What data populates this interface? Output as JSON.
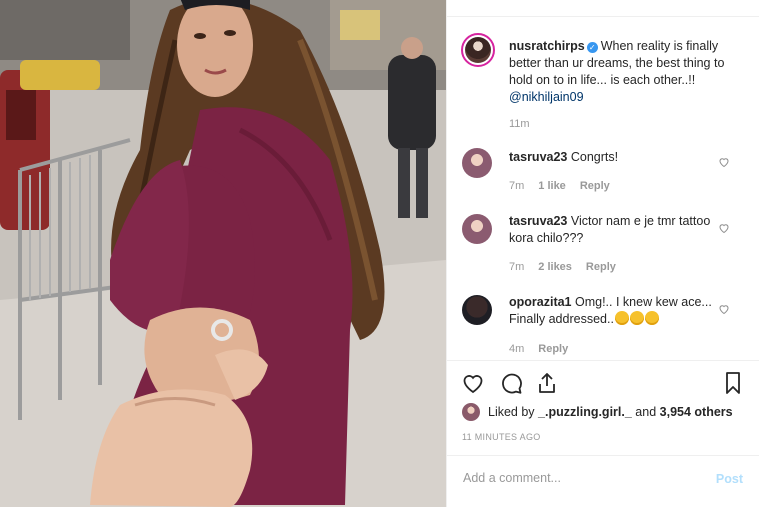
{
  "post": {
    "author": "nusratchirps",
    "caption": "When reality is finally better than ur dreams, the best thing to hold on to in life... is each other..!!",
    "mention": "@nikhiljain09",
    "time": "11m"
  },
  "comments": [
    {
      "user": "tasruva23",
      "text": "Congrts!",
      "time": "7m",
      "likes": "1 like",
      "reply": "Reply"
    },
    {
      "user": "tasruva23",
      "text": "Victor nam e je tmr tattoo kora chilo???",
      "time": "7m",
      "likes": "2 likes",
      "reply": "Reply"
    },
    {
      "user": "oporazita1",
      "text": "Omg!.. I knew kew ace... Finally addressed..",
      "time": "4m",
      "likes": "",
      "reply": "Reply"
    }
  ],
  "actions": {
    "liked_prefix": "Liked by",
    "liked_user": "_.puzzling.girl._",
    "liked_and": "and",
    "liked_count": "3,954 others",
    "timestamp": "11 MINUTES AGO"
  },
  "add_comment": {
    "placeholder": "Add a comment...",
    "post_label": "Post"
  },
  "colors": {
    "link": "#003569",
    "meta": "#999999",
    "verified": "#3897f0",
    "post_disabled": "#b2dffc",
    "coat": "#7b2344"
  }
}
